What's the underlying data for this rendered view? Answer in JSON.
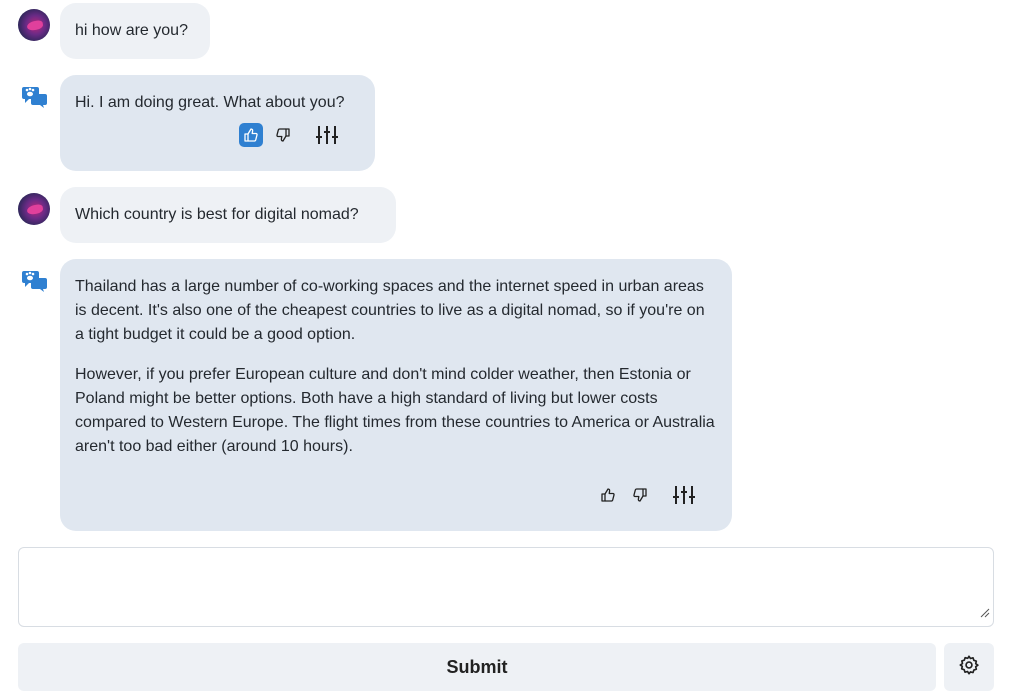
{
  "conversation": [
    {
      "role": "user",
      "text": "hi how are you?"
    },
    {
      "role": "bot",
      "paragraphs": [
        "Hi. I am doing great. What about you?"
      ],
      "thumbs_up_active": true
    },
    {
      "role": "user",
      "text": "Which country is best for digital nomad?"
    },
    {
      "role": "bot",
      "paragraphs": [
        "Thailand has a large number of co-working spaces and the internet speed in urban areas is decent. It's also one of the cheapest countries to live as a digital nomad, so if you're on a tight budget it could be a good option.",
        "However, if you prefer European culture and don't mind colder weather, then Estonia or Poland might be better options. Both have a high standard of living but lower costs compared to Western Europe. The flight times from these countries to America or Australia aren't too bad either (around 10 hours)."
      ],
      "thumbs_up_active": false
    }
  ],
  "composer": {
    "value": "",
    "placeholder": ""
  },
  "submit_label": "Submit",
  "icons": {
    "user_avatar": "avatar-icon",
    "bot_avatar": "chat-bot-icon",
    "thumbs_up": "thumbs-up-icon",
    "thumbs_down": "thumbs-down-icon",
    "adjust": "sliders-icon",
    "settings": "gear-icon"
  },
  "colors": {
    "accent": "#2f80d1",
    "user_bubble": "#eef1f5",
    "bot_bubble": "#e0e7f0"
  }
}
